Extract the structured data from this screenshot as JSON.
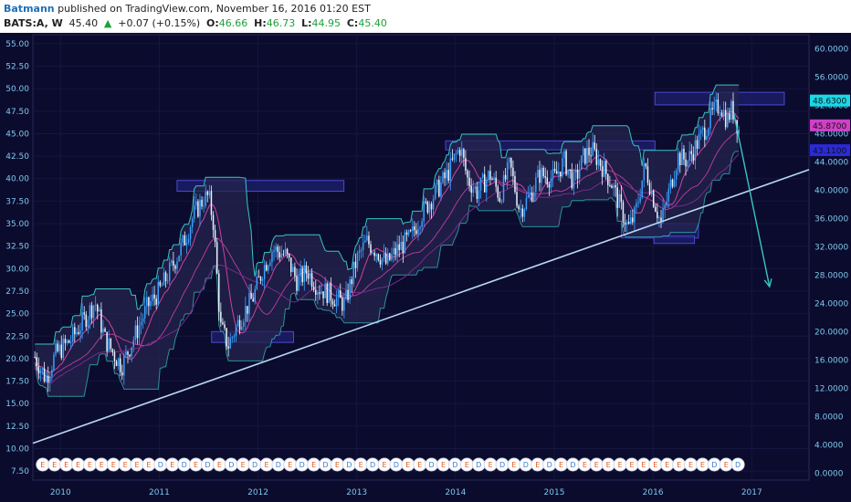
{
  "header": {
    "author": "Batmann",
    "published": "published on TradingView.com, November 16, 2016 01:20 EST",
    "symbol": "BATS:A, W",
    "last": "45.40",
    "arrow": "▲",
    "change": "+0.07 (+0.15%)",
    "o_label": "O:",
    "o_value": "46.66",
    "h_label": "H:",
    "h_value": "46.73",
    "l_label": "L:",
    "l_value": "44.95",
    "c_label": "C:",
    "c_value": "45.40"
  },
  "colors": {
    "background": "#0b0b2e",
    "candle_up": "#3aa0ff",
    "candle_down": "#e8f6ff",
    "axis_text": "#7ec8e8",
    "trendline": "#b8d8ee",
    "box_fill": "#1c1c66",
    "box_stroke": "#4a4ad0",
    "band_cyan": "#36c6c0",
    "band_pink": "#d040a0",
    "earnings_text": "#e05a20",
    "dividend_text": "#3a7ad8"
  },
  "chart_data": {
    "type": "candlestick",
    "timeframe": "W",
    "x_range": [
      2009.72,
      2017.58
    ],
    "x_ticks": [
      "2010",
      "2011",
      "2012",
      "2013",
      "2014",
      "2015",
      "2016",
      "2017"
    ],
    "x_tick_values": [
      2010.0,
      2011.0,
      2012.0,
      2013.0,
      2014.0,
      2015.0,
      2016.0,
      2017.0
    ],
    "left_axis": {
      "range": [
        6.5,
        56.0
      ],
      "ticks": [
        "55.00",
        "52.50",
        "50.00",
        "47.50",
        "45.00",
        "42.50",
        "40.00",
        "37.50",
        "35.00",
        "32.50",
        "30.00",
        "27.50",
        "25.00",
        "22.50",
        "20.00",
        "17.50",
        "15.00",
        "12.50",
        "10.00",
        "7.50"
      ]
    },
    "right_axis": {
      "range": [
        -1.0,
        62.0
      ],
      "ticks": [
        "60.0000",
        "56.0000",
        "52.0000",
        "48.0000",
        "44.0000",
        "40.0000",
        "36.0000",
        "32.0000",
        "28.0000",
        "24.0000",
        "20.0000",
        "16.0000",
        "12.0000",
        "8.0000",
        "4.0000",
        "0.0000"
      ]
    },
    "price_tags": [
      {
        "text": "48.6300",
        "value": 48.63,
        "color": "#19d8e8"
      },
      {
        "text": "45.8700",
        "value": 45.87,
        "color": "#d040c8"
      },
      {
        "text": "43.1100",
        "value": 43.11,
        "color": "#2a2ad8"
      }
    ],
    "price_path": [
      [
        2009.74,
        20.2
      ],
      [
        2009.85,
        17.8
      ],
      [
        2009.95,
        20.5
      ],
      [
        2010.1,
        22.0
      ],
      [
        2010.25,
        24.5
      ],
      [
        2010.35,
        26.3
      ],
      [
        2010.45,
        22.2
      ],
      [
        2010.55,
        20.3
      ],
      [
        2010.62,
        19.2
      ],
      [
        2010.75,
        22.5
      ],
      [
        2010.88,
        25.8
      ],
      [
        2011.0,
        27.5
      ],
      [
        2011.12,
        30.0
      ],
      [
        2011.25,
        33.0
      ],
      [
        2011.35,
        36.0
      ],
      [
        2011.45,
        37.8
      ],
      [
        2011.5,
        38.0
      ],
      [
        2011.55,
        35.0
      ],
      [
        2011.58,
        30.0
      ],
      [
        2011.62,
        23.5
      ],
      [
        2011.7,
        21.5
      ],
      [
        2011.82,
        24.5
      ],
      [
        2011.95,
        26.8
      ],
      [
        2012.05,
        30.0
      ],
      [
        2012.15,
        32.2
      ],
      [
        2012.28,
        31.5
      ],
      [
        2012.4,
        28.5
      ],
      [
        2012.5,
        29.8
      ],
      [
        2012.6,
        28.0
      ],
      [
        2012.75,
        27.0
      ],
      [
        2012.88,
        26.0
      ],
      [
        2013.0,
        31.0
      ],
      [
        2013.1,
        33.0
      ],
      [
        2013.2,
        32.0
      ],
      [
        2013.3,
        30.5
      ],
      [
        2013.4,
        32.0
      ],
      [
        2013.55,
        33.5
      ],
      [
        2013.65,
        36.0
      ],
      [
        2013.8,
        38.5
      ],
      [
        2013.92,
        40.5
      ],
      [
        2014.0,
        42.5
      ],
      [
        2014.05,
        43.5
      ],
      [
        2014.12,
        40.0
      ],
      [
        2014.22,
        38.5
      ],
      [
        2014.35,
        40.5
      ],
      [
        2014.45,
        38.0
      ],
      [
        2014.55,
        41.5
      ],
      [
        2014.65,
        36.5
      ],
      [
        2014.75,
        38.0
      ],
      [
        2014.85,
        40.5
      ],
      [
        2015.0,
        40.0
      ],
      [
        2015.1,
        42.0
      ],
      [
        2015.2,
        39.5
      ],
      [
        2015.3,
        42.5
      ],
      [
        2015.38,
        43.2
      ],
      [
        2015.48,
        41.5
      ],
      [
        2015.58,
        39.5
      ],
      [
        2015.68,
        36.5
      ],
      [
        2015.75,
        34.5
      ],
      [
        2015.82,
        36.0
      ],
      [
        2015.92,
        41.5
      ],
      [
        2016.0,
        38.0
      ],
      [
        2016.08,
        35.0
      ],
      [
        2016.15,
        38.0
      ],
      [
        2016.25,
        42.5
      ],
      [
        2016.35,
        42.0
      ],
      [
        2016.45,
        44.0
      ],
      [
        2016.55,
        46.0
      ],
      [
        2016.62,
        47.5
      ],
      [
        2016.68,
        48.3
      ],
      [
        2016.75,
        46.5
      ],
      [
        2016.8,
        47.8
      ],
      [
        2016.85,
        46.2
      ],
      [
        2016.87,
        45.4
      ]
    ],
    "resistance_boxes": [
      {
        "x": [
          2011.18,
          2012.87
        ],
        "y": [
          38.6,
          39.8
        ]
      },
      {
        "x": [
          2011.53,
          2012.36
        ],
        "y": [
          21.8,
          23.0
        ]
      },
      {
        "x": [
          2013.9,
          2016.02
        ],
        "y": [
          43.2,
          44.2
        ]
      },
      {
        "x": [
          2015.68,
          2016.46
        ],
        "y": [
          33.4,
          35.0
        ]
      },
      {
        "x": [
          2016.01,
          2016.42
        ],
        "y": [
          32.8,
          33.6
        ]
      },
      {
        "x": [
          2016.02,
          2017.33
        ],
        "y": [
          48.2,
          49.6
        ]
      }
    ],
    "trendline": {
      "points": [
        [
          2009.72,
          10.6
        ],
        [
          2017.58,
          41.0
        ]
      ]
    },
    "projection_arrow": {
      "points": [
        [
          2016.82,
          47.2
        ],
        [
          2017.18,
          28.0
        ]
      ]
    },
    "events": [
      {
        "t": "E"
      },
      {
        "t": "E"
      },
      {
        "t": "E"
      },
      {
        "t": "E"
      },
      {
        "t": "E"
      },
      {
        "t": "E"
      },
      {
        "t": "E"
      },
      {
        "t": "E"
      },
      {
        "t": "E"
      },
      {
        "t": "E"
      },
      {
        "t": "D"
      },
      {
        "t": "E"
      },
      {
        "t": "D"
      },
      {
        "t": "E"
      },
      {
        "t": "D"
      },
      {
        "t": "E"
      },
      {
        "t": "D"
      },
      {
        "t": "E"
      },
      {
        "t": "D"
      },
      {
        "t": "E"
      },
      {
        "t": "D"
      },
      {
        "t": "E"
      },
      {
        "t": "D"
      },
      {
        "t": "E"
      },
      {
        "t": "D"
      },
      {
        "t": "E"
      },
      {
        "t": "D"
      },
      {
        "t": "E"
      },
      {
        "t": "D"
      },
      {
        "t": "E"
      },
      {
        "t": "D"
      },
      {
        "t": "E"
      },
      {
        "t": "E"
      },
      {
        "t": "D"
      },
      {
        "t": "E"
      },
      {
        "t": "D"
      },
      {
        "t": "E"
      },
      {
        "t": "D"
      },
      {
        "t": "E"
      },
      {
        "t": "D"
      },
      {
        "t": "E"
      },
      {
        "t": "D"
      },
      {
        "t": "E"
      },
      {
        "t": "D"
      },
      {
        "t": "E"
      },
      {
        "t": "D"
      },
      {
        "t": "E"
      },
      {
        "t": "E"
      },
      {
        "t": "E"
      },
      {
        "t": "E"
      },
      {
        "t": "E"
      },
      {
        "t": "E"
      },
      {
        "t": "E"
      },
      {
        "t": "E"
      },
      {
        "t": "E"
      },
      {
        "t": "E"
      },
      {
        "t": "E"
      },
      {
        "t": "D"
      },
      {
        "t": "E"
      },
      {
        "t": "D"
      }
    ],
    "events_span": [
      2009.82,
      2016.86
    ]
  }
}
